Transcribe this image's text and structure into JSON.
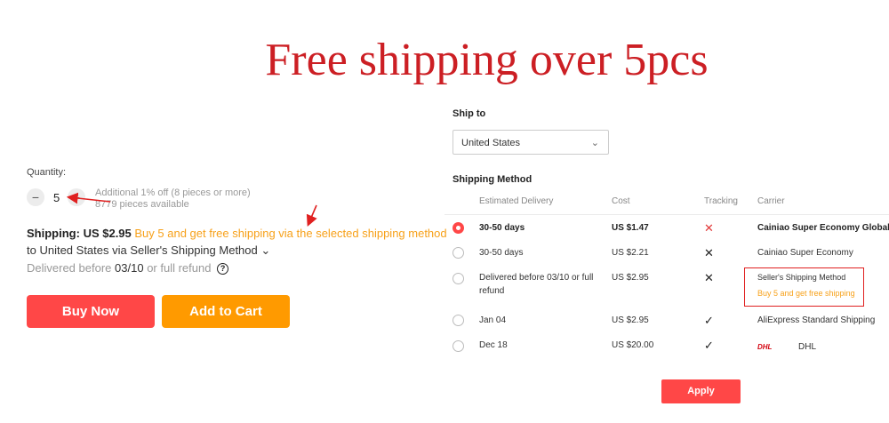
{
  "banner": {
    "text": "Free shipping over 5pcs",
    "color": "#cc1f24"
  },
  "quantity": {
    "label": "Quantity:",
    "minus": "−",
    "value": "5",
    "plus": "+",
    "discount": "Additional 1% off (8 pieces or more)",
    "available": "8779 pieces available"
  },
  "shipping": {
    "label": "Shipping:",
    "price": "US $2.95",
    "promo": "Buy 5 and get free shipping via the selected shipping method",
    "route": "to United States via Seller's Shipping Method",
    "chevron": "⌄",
    "delivered_prefix": "Delivered before",
    "delivered_date": "03/10",
    "delivered_suffix": "or full refund",
    "help_icon": "?"
  },
  "buttons": {
    "buy_now": "Buy Now",
    "add_to_cart": "Add to Cart",
    "apply": "Apply"
  },
  "ship_to": {
    "label": "Ship to",
    "value": "United States",
    "chevron": "⌄"
  },
  "method": {
    "label": "Shipping Method",
    "columns": [
      "Estimated Delivery",
      "Cost",
      "Tracking",
      "Carrier"
    ],
    "rows": [
      {
        "selected": true,
        "delivery": "30-50 days",
        "cost": "US $1.47",
        "tracking": "✕",
        "carrier": "Cainiao Super Economy Global"
      },
      {
        "selected": false,
        "delivery": "30-50 days",
        "cost": "US $2.21",
        "tracking": "✕",
        "carrier": "Cainiao Super Economy"
      },
      {
        "selected": false,
        "delivery": "Delivered before 03/10 or full",
        "delivery2": "refund",
        "cost": "US $2.95",
        "tracking": "✕",
        "carrier": "Seller's Shipping Method",
        "carrier_promo": "Buy 5 and get free shipping"
      },
      {
        "selected": false,
        "delivery": "Jan 04",
        "cost": "US $2.95",
        "tracking": "✓",
        "carrier": "AliExpress Standard Shipping"
      },
      {
        "selected": false,
        "delivery": "Dec 18",
        "cost": "US $20.00",
        "tracking": "✓",
        "carrier": "DHL",
        "carrier_logo": "DHL"
      }
    ]
  },
  "colors": {
    "accent": "#ff4747",
    "orange": "#ff9a00",
    "promo": "#f7a11a",
    "annotation": "#e02020"
  }
}
